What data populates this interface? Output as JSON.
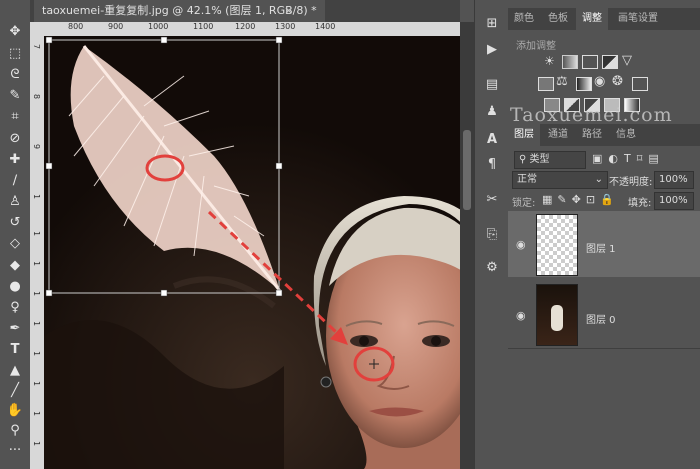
{
  "document": {
    "tab_title": "taoxuemei-重复复制.jpg @ 42.1% (图层 1, RGB/8) *",
    "close_symbol": "×"
  },
  "rulers": {
    "top_labels": [
      "800",
      "900",
      "1000",
      "1100",
      "1200",
      "1300",
      "1400"
    ],
    "left_labels": [
      "7",
      "8",
      "9",
      "1",
      "1",
      "1",
      "1",
      "1",
      "1",
      "1",
      "1",
      "1",
      "2",
      "2"
    ]
  },
  "toolbar": {
    "tools": [
      "move-tool",
      "marquee-tool",
      "lasso-tool",
      "quick-select-tool",
      "crop-tool",
      "eyedropper-tool",
      "healing-brush-tool",
      "brush-tool",
      "clone-stamp-tool",
      "history-brush-tool",
      "eraser-tool",
      "paint-bucket-tool",
      "blur-tool",
      "dodge-tool",
      "pen-tool",
      "type-tool",
      "path-select-tool",
      "line-tool",
      "hand-tool",
      "zoom-tool",
      "more-tools"
    ]
  },
  "panel_tabs_top": {
    "tabs": [
      "颜色",
      "色板",
      "调整",
      "画笔设置"
    ],
    "active": "调整"
  },
  "adjustments": {
    "title": "添加调整"
  },
  "watermark": "Taoxuemei.com",
  "panel_tabs_layers": {
    "tabs": [
      "图层",
      "通道",
      "路径",
      "信息"
    ],
    "active": "图层"
  },
  "layers_panel": {
    "filter_label": "类型",
    "blend_mode": "正常",
    "opacity_label": "不透明度:",
    "opacity_value": "100%",
    "lock_label": "锁定:",
    "fill_label": "填充:",
    "fill_value": "100%",
    "layers": [
      {
        "name": "图层 1",
        "visible": true,
        "selected": true
      },
      {
        "name": "图层 0",
        "visible": true,
        "selected": false
      }
    ]
  },
  "colors": {
    "annotation_red": "#e2403c",
    "feather_color": "#f5d9cf"
  }
}
